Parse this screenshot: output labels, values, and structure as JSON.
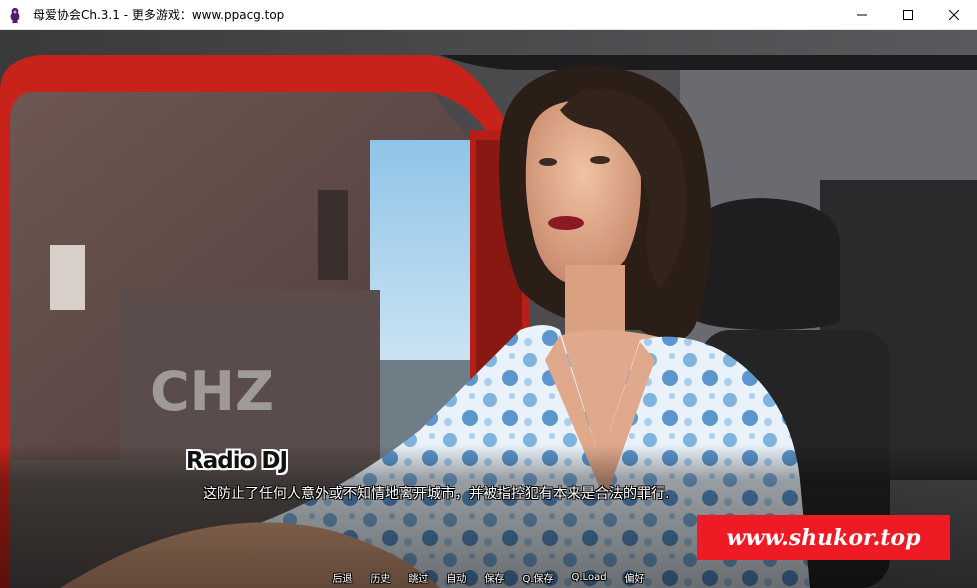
{
  "window": {
    "title": "母爱协会Ch.3.1 - 更多游戏：www.ppacg.top",
    "app_icon": "game-app-icon",
    "controls": [
      "minimize-icon",
      "maximize-icon",
      "close-icon"
    ]
  },
  "dialogue": {
    "speaker": "Radio DJ",
    "text": "这防止了任何人意外或不知情地离开城市，并被指控犯有本来是合法的罪行."
  },
  "watermark": {
    "text": "www.shukor.top",
    "color": "#ee1b24"
  },
  "quick_menu": {
    "back": "后退",
    "history": "历史",
    "skip": "跳过",
    "auto": "自动",
    "save": "保存",
    "quick_save": "Q.保存",
    "quick_load": "Q.Load",
    "prefs": "偏好"
  }
}
